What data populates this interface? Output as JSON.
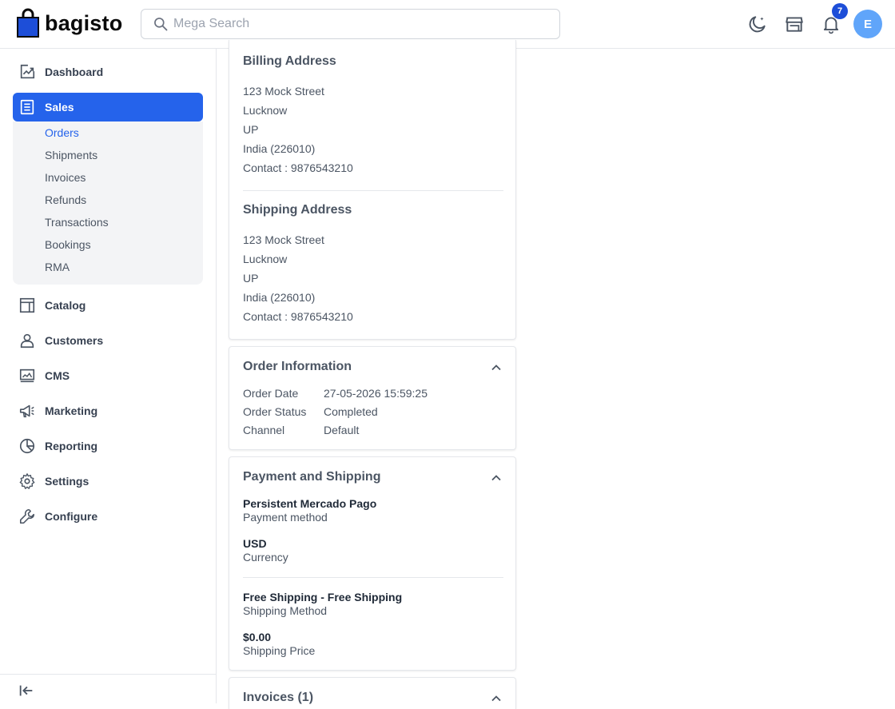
{
  "header": {
    "logo_text": "bagisto",
    "search_placeholder": "Mega Search",
    "notification_count": "7",
    "avatar_initial": "E"
  },
  "sidebar": {
    "items": [
      {
        "label": "Dashboard",
        "icon": "dashboard-icon"
      },
      {
        "label": "Sales",
        "icon": "sales-icon"
      },
      {
        "label": "Catalog",
        "icon": "catalog-icon"
      },
      {
        "label": "Customers",
        "icon": "customers-icon"
      },
      {
        "label": "CMS",
        "icon": "cms-icon"
      },
      {
        "label": "Marketing",
        "icon": "marketing-icon"
      },
      {
        "label": "Reporting",
        "icon": "reporting-icon"
      },
      {
        "label": "Settings",
        "icon": "settings-icon"
      },
      {
        "label": "Configure",
        "icon": "configure-icon"
      }
    ],
    "sales_sub": [
      "Orders",
      "Shipments",
      "Invoices",
      "Refunds",
      "Transactions",
      "Bookings",
      "RMA"
    ]
  },
  "billing": {
    "title": "Billing Address",
    "lines": [
      "123 Mock Street",
      "Lucknow",
      "UP",
      "India (226010)",
      "Contact : 9876543210"
    ]
  },
  "shipping": {
    "title": "Shipping Address",
    "lines": [
      "123 Mock Street",
      "Lucknow",
      "UP",
      "India (226010)",
      "Contact : 9876543210"
    ]
  },
  "order_info": {
    "title": "Order Information",
    "rows": [
      {
        "label": "Order Date",
        "value": "27-05-2026 15:59:25"
      },
      {
        "label": "Order Status",
        "value": "Completed"
      },
      {
        "label": "Channel",
        "value": "Default"
      }
    ]
  },
  "payment_shipping": {
    "title": "Payment and Shipping",
    "payment_method_value": "Persistent Mercado Pago",
    "payment_method_label": "Payment method",
    "currency_value": "USD",
    "currency_label": "Currency",
    "shipping_method_value": "Free Shipping - Free Shipping",
    "shipping_method_label": "Shipping Method",
    "shipping_price_value": "$0.00",
    "shipping_price_label": "Shipping Price"
  },
  "invoices": {
    "title": "Invoices (1)"
  },
  "colors": {
    "accent": "#2563eb",
    "badge": "#1d4ed8",
    "avatar": "#60a5fa"
  }
}
